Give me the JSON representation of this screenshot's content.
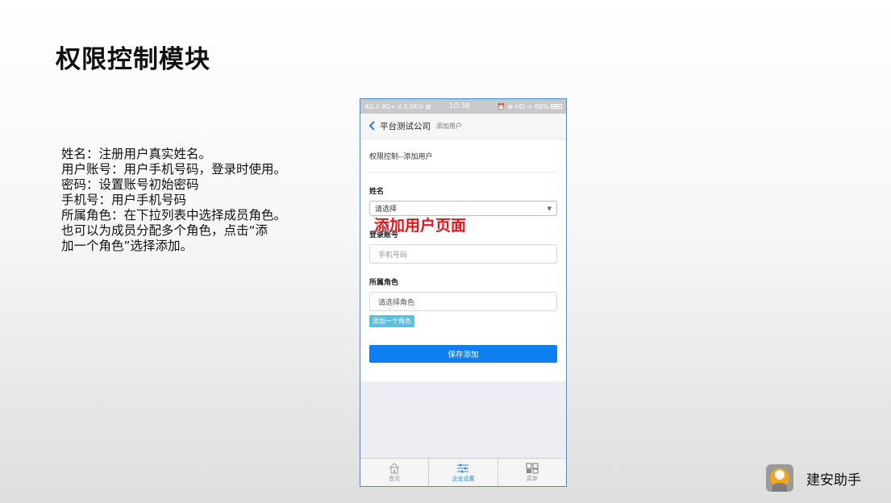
{
  "slide": {
    "title": "权限控制模块",
    "description": [
      "姓名：注册用户真实姓名。",
      "用户账号：用户手机号码，登录时使用。",
      "密码：设置账号初始密码",
      "手机号：用户手机号码",
      "所属角色：在下拉列表中选择成员角色。",
      "也可以为成员分配多个角色，点击“添",
      "加一个角色”选择添加。"
    ],
    "brand_name": "建安助手"
  },
  "phone": {
    "statusbar": {
      "left": "4G.ıl 4G+.ıl 0.5K/s ⊠",
      "time": "10:38",
      "right": "⏰ ⊗ HD ᯤ 88%"
    },
    "navbar": {
      "title": "平台测试公司",
      "subtitle": "添加用户"
    },
    "section_title": "权限控制--添加用户",
    "name_label": "姓名",
    "name_select": "请选择",
    "overlay_label": "添加用户页面",
    "account_label": "登录账号",
    "phone_placeholder": "手机号码",
    "role_label": "所属角色",
    "role_placeholder": "请选择角色",
    "add_role_button": "添加一个角色",
    "save_button": "保存添加",
    "tabs": [
      {
        "label": "首页",
        "icon": "home-icon",
        "active": false
      },
      {
        "label": "企业设置",
        "icon": "sliders-icon",
        "active": true
      },
      {
        "label": "菜单",
        "icon": "grid-icon",
        "active": false
      }
    ]
  },
  "colors": {
    "accent": "#0f7ef0",
    "overlay_red": "#e3141a",
    "add_role": "#5bc0de"
  }
}
